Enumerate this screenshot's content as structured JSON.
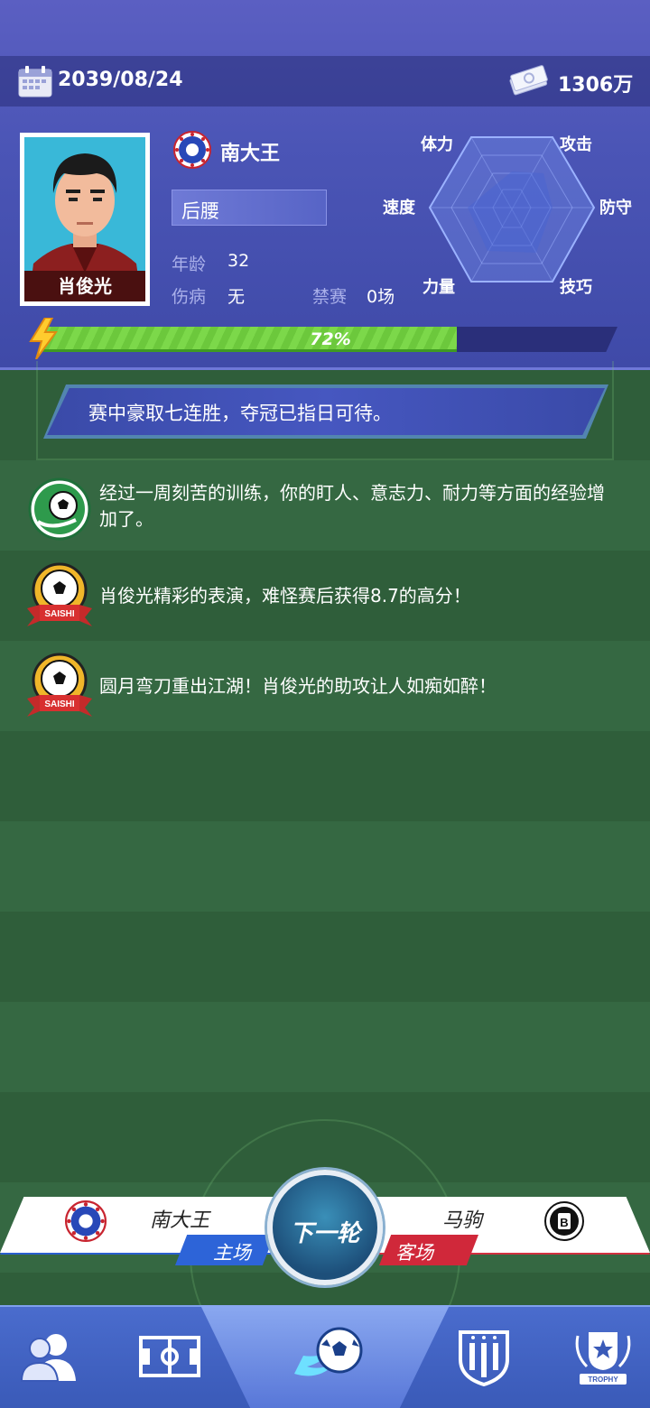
{
  "header": {
    "date": "2039/08/24",
    "money": "1306万",
    "player_name": "肖俊光",
    "club_name": "南大王",
    "position": "后腰",
    "age_label": "年龄",
    "age_value": "32",
    "injury_label": "伤病",
    "injury_value": "无",
    "ban_label": "禁赛",
    "ban_value": "0场",
    "energy_percent": 72,
    "energy_text": "72%"
  },
  "radar": {
    "labels": {
      "stamina": "体力",
      "attack": "攻击",
      "speed": "速度",
      "defense": "防守",
      "strength": "力量",
      "skill": "技巧"
    }
  },
  "news": {
    "banner": "赛中豪取七连胜，夺冠已指日可待。",
    "items": [
      {
        "icon": "training-ball-icon",
        "text": "经过一周刻苦的训练，你的盯人、意志力、耐力等方面的经验增加了。"
      },
      {
        "icon": "saishi-badge-icon",
        "text": "肖俊光精彩的表演，难怪赛后获得8.7的高分！"
      },
      {
        "icon": "saishi-badge-icon",
        "text": "圆月弯刀重出江湖！肖俊光的助攻让人如痴如醉！"
      }
    ],
    "badge_text": "SAISHI"
  },
  "match": {
    "home_name": "南大王",
    "home_tag": "主场",
    "away_name": "马驹",
    "away_tag": "客场",
    "next_label": "下一轮"
  },
  "nav": {
    "items": [
      "team-icon",
      "pitch-icon",
      "match-icon",
      "club-icon",
      "trophy-icon"
    ],
    "trophy_text": "TROPHY",
    "active_index": 2
  }
}
